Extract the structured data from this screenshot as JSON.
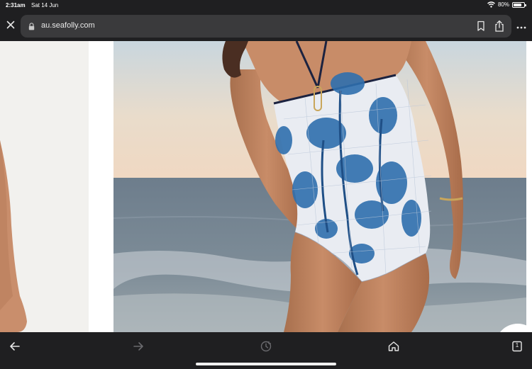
{
  "status_bar": {
    "time": "2:31am",
    "date": "Sat 14 Jun",
    "battery_percent": "80%",
    "battery_level": 0.8,
    "icons": [
      "wifi-icon",
      "battery-icon"
    ]
  },
  "address_bar": {
    "url": "au.seafolly.com",
    "close_label": "×",
    "more_label": "•••",
    "icons": [
      "close-icon",
      "lock-icon",
      "bookmark-icon",
      "share-icon",
      "more-icon"
    ]
  },
  "toolbar": {
    "icons": [
      "back-arrow-icon",
      "forward-arrow-icon",
      "history-icon",
      "home-icon",
      "tabs-icon"
    ],
    "tabs_count": "1",
    "enabled": {
      "back": true,
      "forward": false,
      "history": false,
      "home": true,
      "tabs": true
    }
  },
  "page": {
    "colors": {
      "ui_bar": "#1f1f21",
      "url_field": "#3a3a3c",
      "page_background": "#ffffff",
      "swimsuit_base": "#e9ecf2",
      "print_blue": "#2f6fae",
      "trim": "#1c2340"
    }
  }
}
